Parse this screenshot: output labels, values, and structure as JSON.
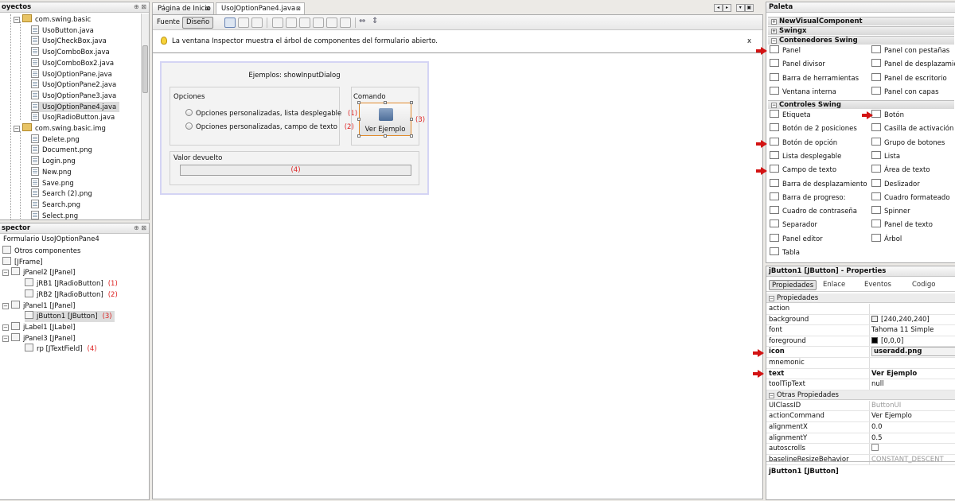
{
  "projects": {
    "title": "oyectos",
    "controls": "⊕ ⊠",
    "items": [
      {
        "label": "com.swing.basic",
        "kind": "package"
      },
      {
        "label": "UsoButton.java",
        "kind": "file"
      },
      {
        "label": "UsoJCheckBox.java",
        "kind": "file"
      },
      {
        "label": "UsoJComboBox.java",
        "kind": "file"
      },
      {
        "label": "UsoJComboBox2.java",
        "kind": "file"
      },
      {
        "label": "UsoJOptionPane.java",
        "kind": "file"
      },
      {
        "label": "UsoJOptionPane2.java",
        "kind": "file"
      },
      {
        "label": "UsoJOptionPane3.java",
        "kind": "file"
      },
      {
        "label": "UsoJOptionPane4.java",
        "kind": "file",
        "selected": true
      },
      {
        "label": "UsoJRadioButton.java",
        "kind": "file"
      },
      {
        "label": "com.swing.basic.img",
        "kind": "package"
      },
      {
        "label": "Delete.png",
        "kind": "file"
      },
      {
        "label": "Document.png",
        "kind": "file"
      },
      {
        "label": "Login.png",
        "kind": "file"
      },
      {
        "label": "New.png",
        "kind": "file"
      },
      {
        "label": "Save.png",
        "kind": "file"
      },
      {
        "label": "Search (2).png",
        "kind": "file"
      },
      {
        "label": "Search.png",
        "kind": "file"
      },
      {
        "label": "Select.png",
        "kind": "file"
      }
    ]
  },
  "inspector": {
    "title": "spector",
    "controls": "⊕ ⊠",
    "form_label": "Formulario UsoJOptionPane4",
    "items": [
      {
        "label": "Otros componentes",
        "indent": 0
      },
      {
        "label": "[JFrame]",
        "indent": 0
      },
      {
        "label": "jPanel2 [JPanel]",
        "indent": 1
      },
      {
        "label": "jRB1 [JRadioButton]",
        "indent": 2,
        "mark": "(1)"
      },
      {
        "label": "jRB2 [JRadioButton]",
        "indent": 2,
        "mark": "(2)"
      },
      {
        "label": "jPanel1 [JPanel]",
        "indent": 1
      },
      {
        "label": "jButton1 [JButton]",
        "indent": 2,
        "mark": "(3)",
        "selected": true
      },
      {
        "label": "jLabel1 [JLabel]",
        "indent": 1
      },
      {
        "label": "jPanel3 [JPanel]",
        "indent": 1
      },
      {
        "label": "rp [JTextField]",
        "indent": 2,
        "mark": "(4)"
      }
    ]
  },
  "editor": {
    "tabs": [
      {
        "label": "Página de Inicio",
        "close": "⊠"
      },
      {
        "label": "UsoJOptionPane4.java",
        "close": "⊠",
        "active": true
      }
    ],
    "views": {
      "source": "Fuente",
      "design": "Diseño"
    },
    "info_text": "La ventana Inspector muestra el árbol de componentes del formulario abierto.",
    "info_close": "x",
    "form": {
      "title_label": "Ejemplos: showInputDialog",
      "options_title": "Opciones",
      "radio1": "Opciones personalizadas, lista desplegable",
      "radio1_mark": "(1)",
      "radio2": "Opciones personalizadas, campo de texto",
      "radio2_mark": "(2)",
      "command_title": "Comando",
      "button_label": "Ver Ejemplo",
      "button_mark": "(3)",
      "result_title": "Valor devuelto",
      "field_mark": "(4)"
    }
  },
  "palette": {
    "title": "Paleta",
    "sections": [
      {
        "label": "NewVisualComponent",
        "expanded": false
      },
      {
        "label": "Swingx",
        "expanded": false
      },
      {
        "label": "Contenedores Swing",
        "expanded": true
      },
      {
        "label": "Controles Swing",
        "expanded": true
      }
    ],
    "containers": [
      [
        "Panel",
        "Panel con pestañas"
      ],
      [
        "Panel divisor",
        "Panel de desplazamiento"
      ],
      [
        "Barra de herramientas",
        "Panel de escritorio"
      ],
      [
        "Ventana interna",
        "Panel con capas"
      ]
    ],
    "controls": [
      [
        "Etiqueta",
        "Botón"
      ],
      [
        "Botón de 2 posiciones",
        "Casilla de activación"
      ],
      [
        "Botón de opción",
        "Grupo de botones"
      ],
      [
        "Lista desplegable",
        "Lista"
      ],
      [
        "Campo de texto",
        "Área de texto"
      ],
      [
        "Barra de desplazamiento",
        "Deslizador"
      ],
      [
        "Barra de progreso:",
        "Cuadro formateado"
      ],
      [
        "Cuadro de contraseña",
        "Spinner"
      ],
      [
        "Separador",
        "Panel de texto"
      ],
      [
        "Panel editor",
        "Árbol"
      ],
      [
        "Tabla",
        ""
      ]
    ]
  },
  "properties": {
    "title": "jButton1 [JButton] - Properties",
    "tabs": [
      "Propiedades",
      "Enlace",
      "Eventos",
      "Codigo"
    ],
    "cat1": "Propiedades",
    "rows1": [
      {
        "name": "action",
        "value": ""
      },
      {
        "name": "background",
        "value": "[240,240,240]",
        "swatch": "#f0f0f0"
      },
      {
        "name": "font",
        "value": "Tahoma 11 Simple"
      },
      {
        "name": "foreground",
        "value": "[0,0,0]",
        "swatch": "#000000"
      },
      {
        "name": "icon",
        "value": "useradd.png",
        "bold": true
      },
      {
        "name": "mnemonic",
        "value": ""
      },
      {
        "name": "text",
        "value": "Ver Ejemplo",
        "bold": true
      },
      {
        "name": "toolTipText",
        "value": "null"
      }
    ],
    "cat2": "Otras Propiedades",
    "rows2": [
      {
        "name": "UIClassID",
        "value": "ButtonUI",
        "muted": true
      },
      {
        "name": "actionCommand",
        "value": "Ver Ejemplo"
      },
      {
        "name": "alignmentX",
        "value": "0.0"
      },
      {
        "name": "alignmentY",
        "value": "0.5"
      },
      {
        "name": "autoscrolls",
        "value": ""
      },
      {
        "name": "baselineResizeBehavior",
        "value": "CONSTANT_DESCENT",
        "muted": true
      }
    ],
    "footer": "jButton1 [JButton]"
  },
  "colors": {
    "accent_red": "#d22222",
    "selection": "#dcdcdc",
    "form_border": "#c9c9f0"
  }
}
